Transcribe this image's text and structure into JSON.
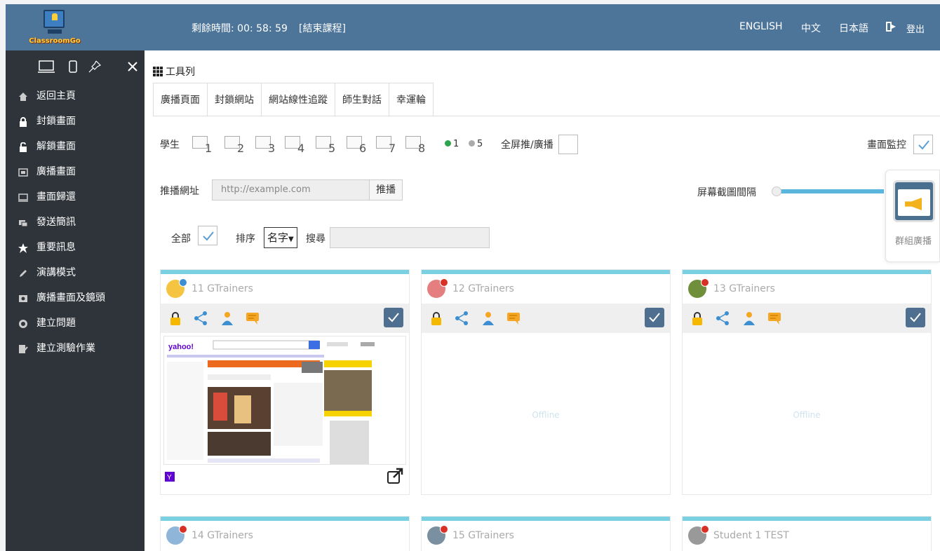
{
  "app": {
    "logo_text": "ClassroomGo",
    "timer": "剩餘時間: 00: 58: 59",
    "end_class": "[結束課程]",
    "languages": [
      "ENGLISH",
      "中文",
      "日本語"
    ],
    "logout": "登出"
  },
  "sidebar": {
    "items": [
      {
        "label": "返回主頁",
        "icon": "home-icon"
      },
      {
        "label": "封鎖畫面",
        "icon": "lock-icon"
      },
      {
        "label": "解鎖畫面",
        "icon": "unlock-icon"
      },
      {
        "label": "廣播畫面",
        "icon": "broadcast-screen-icon"
      },
      {
        "label": "畫面歸還",
        "icon": "monitor-icon"
      },
      {
        "label": "發送簡訊",
        "icon": "message-icon"
      },
      {
        "label": "重要訊息",
        "icon": "star-icon"
      },
      {
        "label": "演講模式",
        "icon": "pen-icon"
      },
      {
        "label": "廣播畫面及鏡頭",
        "icon": "camera-screen-icon"
      },
      {
        "label": "建立問題",
        "icon": "question-icon"
      },
      {
        "label": "建立測驗作業",
        "icon": "quiz-icon"
      }
    ]
  },
  "toolbar": {
    "title": "工具列",
    "tabs": [
      "廣播頁面",
      "封鎖網站",
      "網站線性追蹤",
      "師生對話",
      "幸運輪"
    ],
    "students_label": "學生",
    "layouts": [
      "1",
      "2",
      "3",
      "4",
      "5",
      "6",
      "7",
      "8"
    ],
    "online_count": "1",
    "total_count": "5",
    "fullscreen_label": "全屏推/廣播",
    "monitor_label": "畫面監控",
    "push_url_label": "推播網址",
    "push_url_placeholder": "http://example.com",
    "push_button": "推播",
    "interval_label": "屏幕截圖間隔",
    "all_label": "全部",
    "sort_label": "排序",
    "sort_value": "名字",
    "search_label": "搜尋"
  },
  "group_broadcast": {
    "label": "群組廣播"
  },
  "students": [
    {
      "name": "11 GTrainers",
      "status": "online",
      "body": "screen"
    },
    {
      "name": "12 GTrainers",
      "status": "offline",
      "body": "Offline"
    },
    {
      "name": "13 GTrainers",
      "status": "offline",
      "body": "Offline"
    },
    {
      "name": "14 GTrainers",
      "status": "offline",
      "body": ""
    },
    {
      "name": "15 GTrainers",
      "status": "offline",
      "body": ""
    },
    {
      "name": "Student 1 TEST",
      "status": "offline",
      "body": ""
    }
  ],
  "colors": {
    "topbar": "#4d7599",
    "sidebar": "#2f343b",
    "card_accent": "#79d0e0",
    "check_bg": "#4f6f90",
    "online_dot": "#2ea44f",
    "offline_dot": "#999999"
  }
}
